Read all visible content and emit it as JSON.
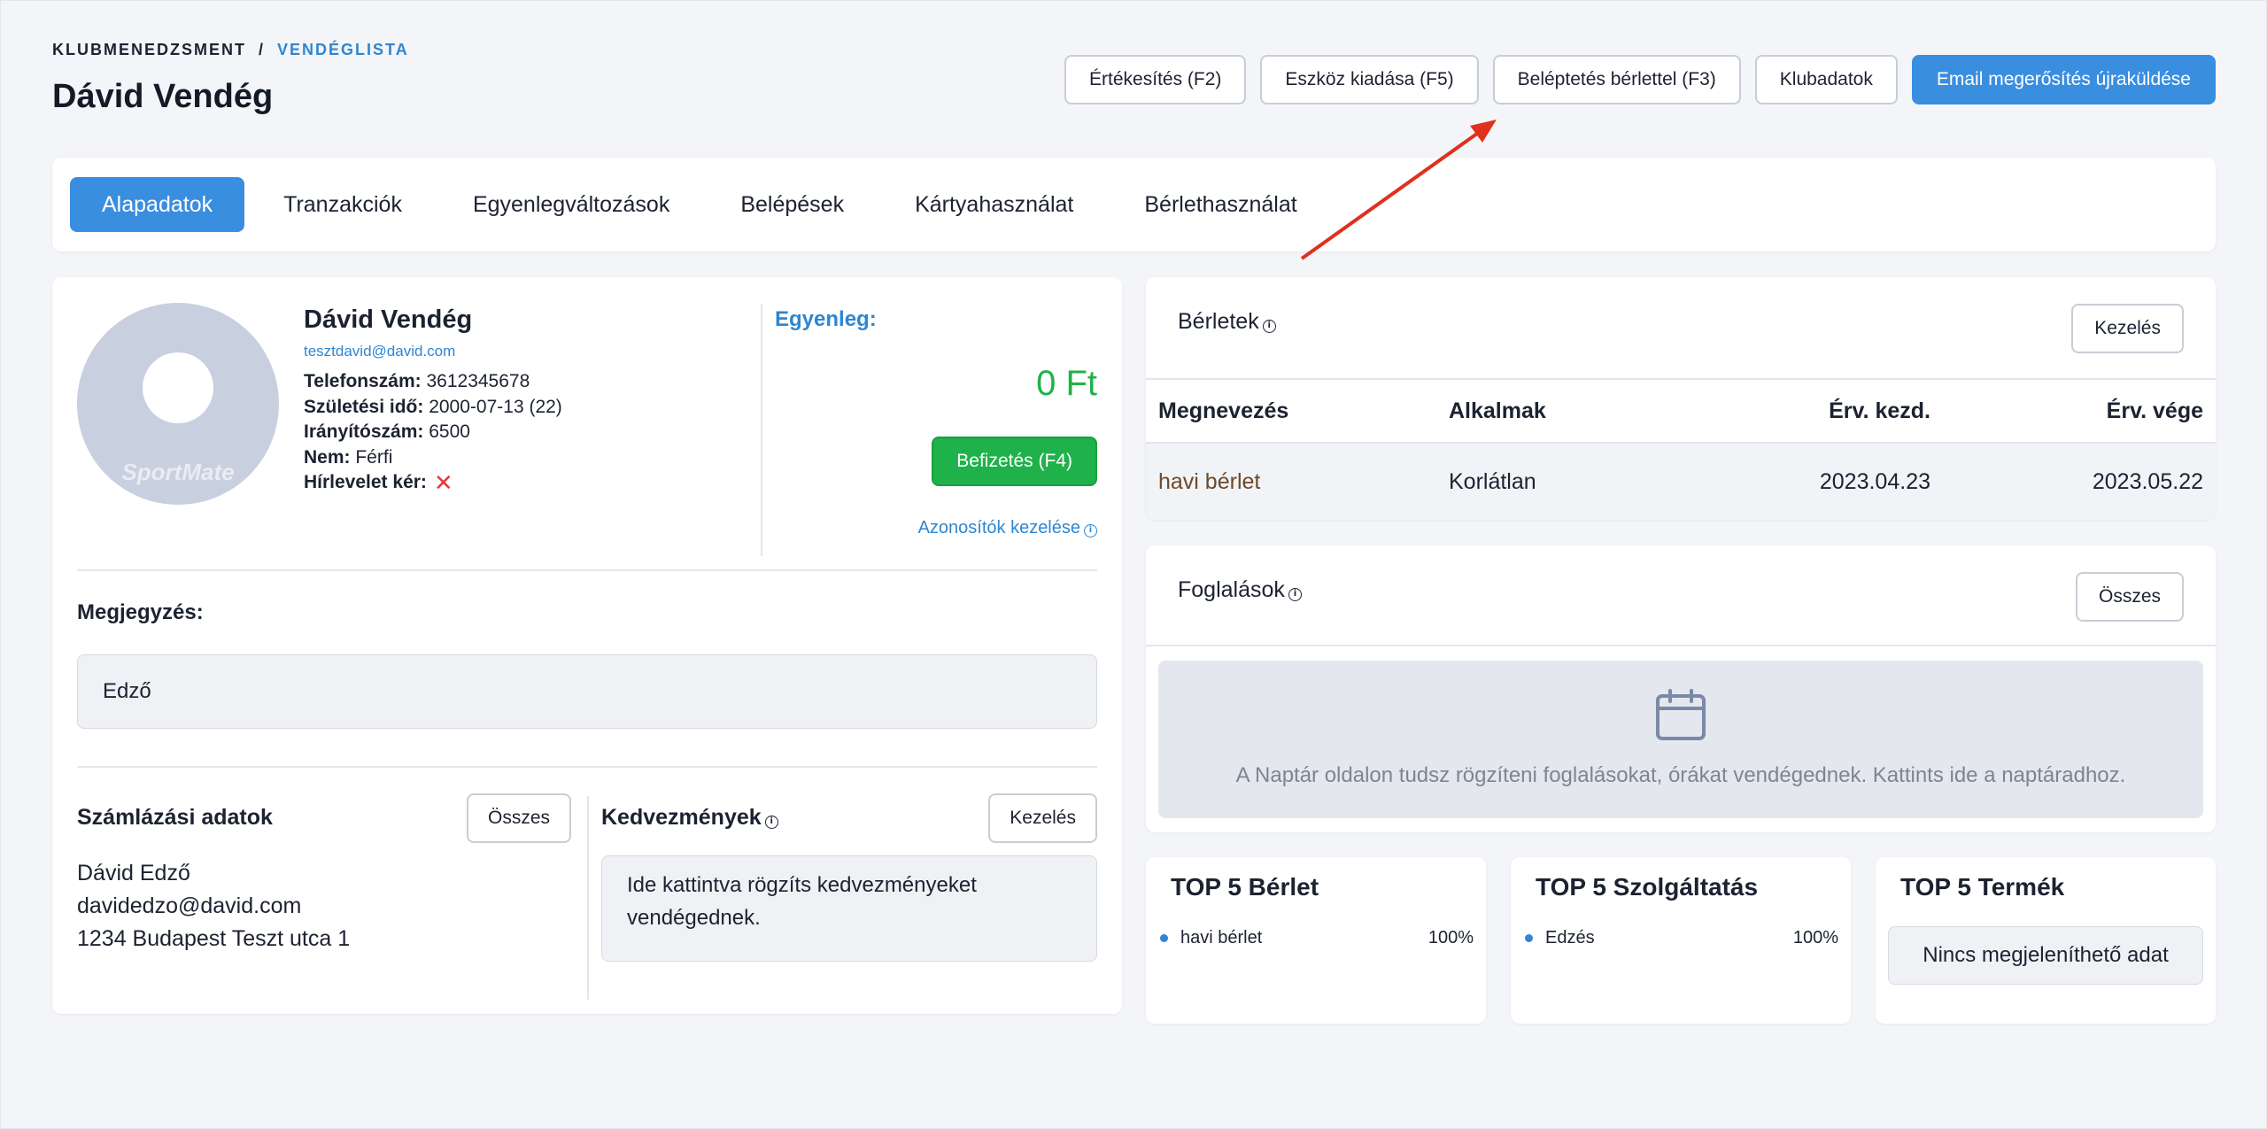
{
  "breadcrumb": {
    "root": "KLUBMENEDZSMENT",
    "separator": "/",
    "current": "VENDÉGLISTA"
  },
  "page_title": "Dávid Vendég",
  "actions": {
    "sales": "Értékesítés (F2)",
    "equipment": "Eszköz kiadása (F5)",
    "checkin_pass": "Beléptetés bérlettel (F3)",
    "club_data": "Klubadatok",
    "resend_email": "Email megerősítés újraküldése"
  },
  "tabs": [
    "Alapadatok",
    "Tranzakciók",
    "Egyenlegváltozások",
    "Belépések",
    "Kártyahasználat",
    "Bérlethasználat"
  ],
  "profile": {
    "avatar_logo": "SportMate",
    "name": "Dávid Vendég",
    "email": "tesztdavid@david.com",
    "phone_label": "Telefonszám:",
    "phone": "3612345678",
    "birth_label": "Születési idő:",
    "birth": "2000-07-13 (22)",
    "zip_label": "Irányítószám:",
    "zip": "6500",
    "gender_label": "Nem:",
    "gender": "Férfi",
    "newsletter_label": "Hírlevelet kér:"
  },
  "balance": {
    "label": "Egyenleg:",
    "value": "0 Ft",
    "pay_button": "Befizetés (F4)",
    "ids_link": "Azonosítók kezelése"
  },
  "note": {
    "label": "Megjegyzés:",
    "value": "Edző"
  },
  "billing": {
    "label": "Számlázási adatok",
    "all_button": "Összes",
    "lines": [
      "Dávid Edző",
      "davidedzo@david.com",
      "1234 Budapest Teszt utca 1"
    ]
  },
  "discounts": {
    "label": "Kedvezmények",
    "manage_button": "Kezelés",
    "placeholder": "Ide kattintva rögzíts kedvezményeket vendégednek."
  },
  "passes": {
    "title": "Bérletek",
    "manage_button": "Kezelés",
    "columns": [
      "Megnevezés",
      "Alkalmak",
      "Érv. kezd.",
      "Érv. vége"
    ],
    "rows": [
      [
        "havi bérlet",
        "Korlátlan",
        "2023.04.23",
        "2023.05.22"
      ]
    ]
  },
  "bookings": {
    "title": "Foglalások",
    "all_button": "Összes",
    "empty_text": "A Naptár oldalon tudsz rögzíteni foglalásokat, órákat vendégednek. Kattints ide a naptáradhoz."
  },
  "top5": [
    {
      "title": "TOP 5 Bérlet",
      "item": "havi bérlet",
      "percent": "100%"
    },
    {
      "title": "TOP 5 Szolgáltatás",
      "item": "Edzés",
      "percent": "100%"
    },
    {
      "title": "TOP 5 Termék",
      "no_data": "Nincs megjeleníthető adat"
    }
  ],
  "colors": {
    "accent": "#3a8ee0",
    "link": "#2f86d1",
    "success": "#1fb24a",
    "danger": "#e23a3a",
    "annotation_arrow": "#e0301e"
  }
}
